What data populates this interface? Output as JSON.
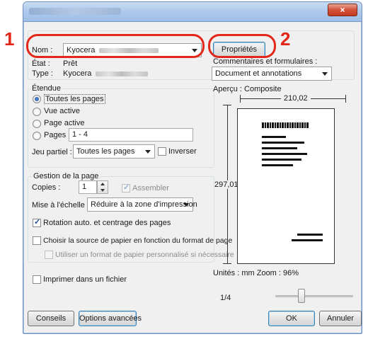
{
  "window": {
    "close_icon": "×"
  },
  "printer": {
    "name_label": "Nom :",
    "name_value": "Kyocera",
    "state_label": "État :",
    "state_value": "Prêt",
    "type_label": "Type :",
    "type_value": "Kyocera",
    "properties_button": "Propriétés",
    "comments_label": "Commentaires et formulaires :",
    "comments_value": "Document et annotations"
  },
  "range": {
    "title": "Étendue",
    "all_pages": "Toutes les pages",
    "current_view": "Vue active",
    "current_page": "Page active",
    "pages": "Pages",
    "pages_value": "1 - 4",
    "subset_label": "Jeu partiel :",
    "subset_value": "Toutes les pages",
    "reverse": "Inverser"
  },
  "page_handling": {
    "title": "Gestion de la page",
    "copies_label": "Copies :",
    "copies_value": "1",
    "collate": "Assembler",
    "scaling_label": "Mise à l'échelle :",
    "scaling_value": "Réduire à la zone d'impression",
    "auto_rotate": "Rotation auto. et centrage des pages",
    "paper_source": "Choisir la source de papier en fonction du format de page",
    "custom_paper": "Utiliser un format de papier personnalisé si nécessaire"
  },
  "print_to_file": "Imprimer dans un fichier",
  "preview": {
    "title": "Aperçu : Composite",
    "width": "210,02",
    "height": "297,01",
    "units": "Unités : mm Zoom :  96%",
    "page": "1/4",
    "page_fraction": 0.25
  },
  "buttons": {
    "tips": "Conseils",
    "advanced": "Options avancées",
    "ok": "OK",
    "cancel": "Annuler"
  },
  "annotations": {
    "one": "1",
    "two": "2"
  },
  "colors": {
    "annotation": "#e3271a",
    "accent": "#3c7fb1"
  }
}
